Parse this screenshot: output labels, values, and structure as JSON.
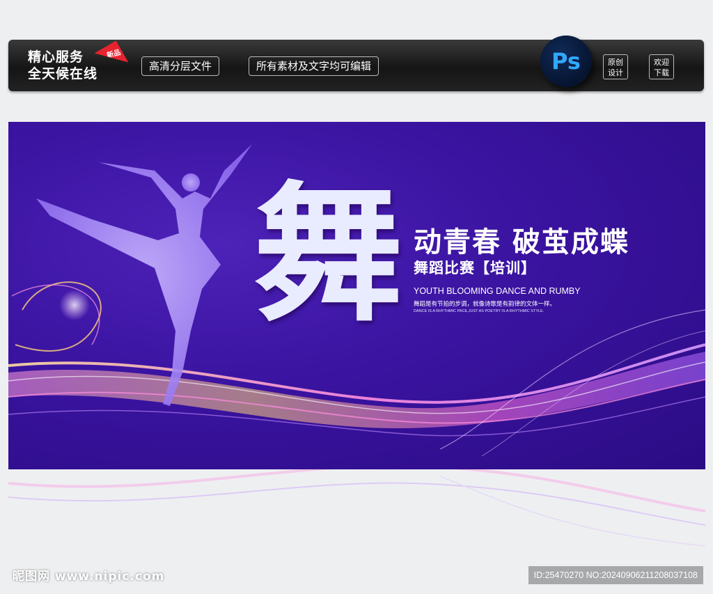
{
  "topbar": {
    "service_line1": "精心服务",
    "service_line2": "全天候在线",
    "badge": "新品",
    "pill1": "高清分层文件",
    "pill2": "所有素材及文字均可编辑",
    "ps_label": "Ps",
    "sq1_line1": "原创",
    "sq1_line2": "设计",
    "sq2_line1": "欢迎",
    "sq2_line2": "下载"
  },
  "banner": {
    "big_char": "舞",
    "headline": "动青春  破茧成蝶",
    "subheadline": "舞蹈比赛【培训】",
    "english_title": "YOUTH BLOOMING DANCE AND RUMBY",
    "chinese_small": "舞蹈是有节拍的步调，就像诗歌是有韵律的文体一样。",
    "english_small": "DANCE IS A RHYTHMIC PACE,JUST AS POETRY IS A RHYTHMIC STYLE."
  },
  "footer": {
    "site": "昵图网 www.nipic.com",
    "id_text": "ID:25470270 NO:20240906211208037108"
  },
  "colors": {
    "banner_bg": "#3a13a0",
    "accent_pink": "#ff5bd2",
    "accent_gold": "#ffc16b",
    "ps_blue": "#31a8ff"
  }
}
